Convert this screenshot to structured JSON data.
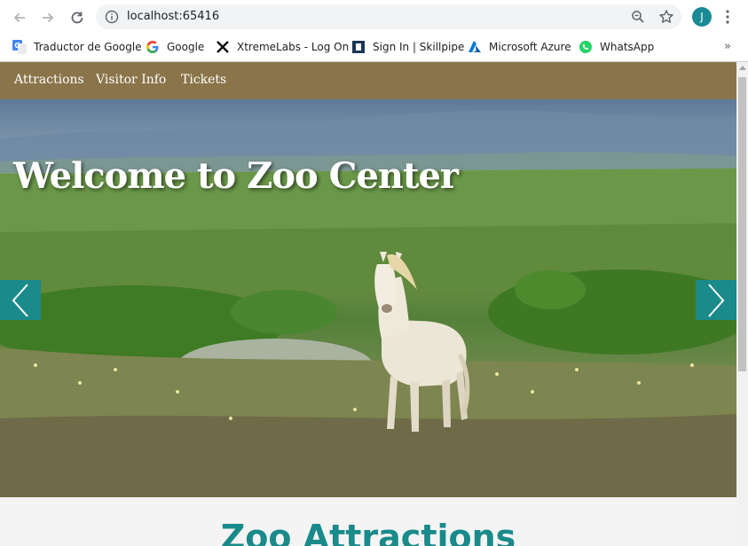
{
  "browser": {
    "url": "localhost:65416",
    "avatar_letter": "J",
    "bookmarks": [
      {
        "label": "Traductor de Google",
        "icon": "google-translate-icon"
      },
      {
        "label": "Google",
        "icon": "google-icon"
      },
      {
        "label": "XtremeLabs - Log On",
        "icon": "xtremelabs-icon"
      },
      {
        "label": "Sign In | Skillpipe",
        "icon": "skillpipe-icon"
      },
      {
        "label": "Microsoft Azure",
        "icon": "azure-icon"
      },
      {
        "label": "WhatsApp",
        "icon": "whatsapp-icon"
      }
    ],
    "bookmarks_more": "»"
  },
  "site": {
    "nav": [
      {
        "label": "Attractions"
      },
      {
        "label": "Visitor Info"
      },
      {
        "label": "Tickets"
      }
    ],
    "hero": {
      "title": "Welcome to Zoo Center",
      "image": "white horse in a green meadow with mountains"
    },
    "section_title": "Zoo Attractions"
  },
  "colors": {
    "nav_background": "#8a754a",
    "accent_teal": "#1a8a8a",
    "avatar": "#1a8a96"
  }
}
